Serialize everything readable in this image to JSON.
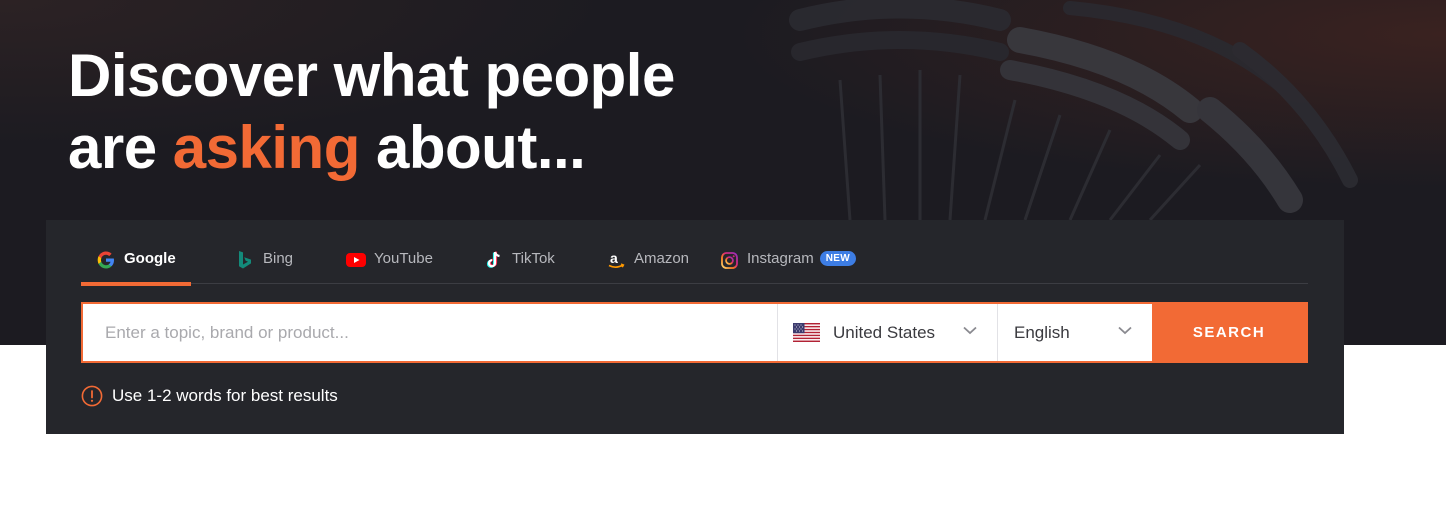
{
  "hero": {
    "headline_part1": "Discover what people",
    "headline_part2": "are",
    "headline_accent": "asking",
    "headline_part3": "about..."
  },
  "tabs": [
    {
      "label": "Google",
      "icon": "google-icon",
      "active": true
    },
    {
      "label": "Bing",
      "icon": "bing-icon",
      "active": false
    },
    {
      "label": "YouTube",
      "icon": "youtube-icon",
      "active": false
    },
    {
      "label": "TikTok",
      "icon": "tiktok-icon",
      "active": false
    },
    {
      "label": "Amazon",
      "icon": "amazon-icon",
      "active": false
    },
    {
      "label": "Instagram",
      "icon": "instagram-icon",
      "active": false,
      "badge": "NEW"
    }
  ],
  "search": {
    "placeholder": "Enter a topic, brand or product...",
    "value": "",
    "country": "United States",
    "language": "English",
    "button_label": "SEARCH"
  },
  "hint": {
    "text": "Use 1-2 words for best results"
  },
  "colors": {
    "accent": "#f26a35",
    "panel": "#25262b",
    "hero_bg": "#1c1b21",
    "badge": "#3d7de4"
  }
}
